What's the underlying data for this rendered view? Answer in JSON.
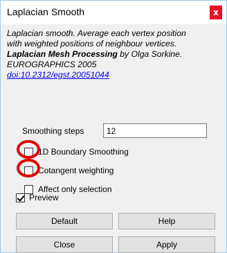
{
  "window": {
    "title": "Laplacian Smooth",
    "close_glyph": "x"
  },
  "description": {
    "line1": "Laplacian smooth. Average each vertex position",
    "line2": "with weighted positions of neighbour vertices.",
    "paper_title": "Laplacian Mesh Processing",
    "author": " by Olga Sorkine.",
    "venue": "EUROGRAPHICS 2005",
    "doi": "doi:10.2312/egst.20051044"
  },
  "params": {
    "smoothing_steps_label": "Smoothing steps",
    "smoothing_steps_value": "12",
    "boundary_label": "1D Boundary Smoothing",
    "boundary_checked": false,
    "cotangent_label": "Cotangent weighting",
    "cotangent_checked": false,
    "selection_label": "Affect only selection",
    "selection_checked": false
  },
  "preview": {
    "label": "Preview",
    "checked": true
  },
  "buttons": {
    "default": "Default",
    "help": "Help",
    "close": "Close",
    "apply": "Apply"
  },
  "colors": {
    "close_button": "#e81123",
    "annotation_circle": "#e00000",
    "link": "#0000ee"
  }
}
